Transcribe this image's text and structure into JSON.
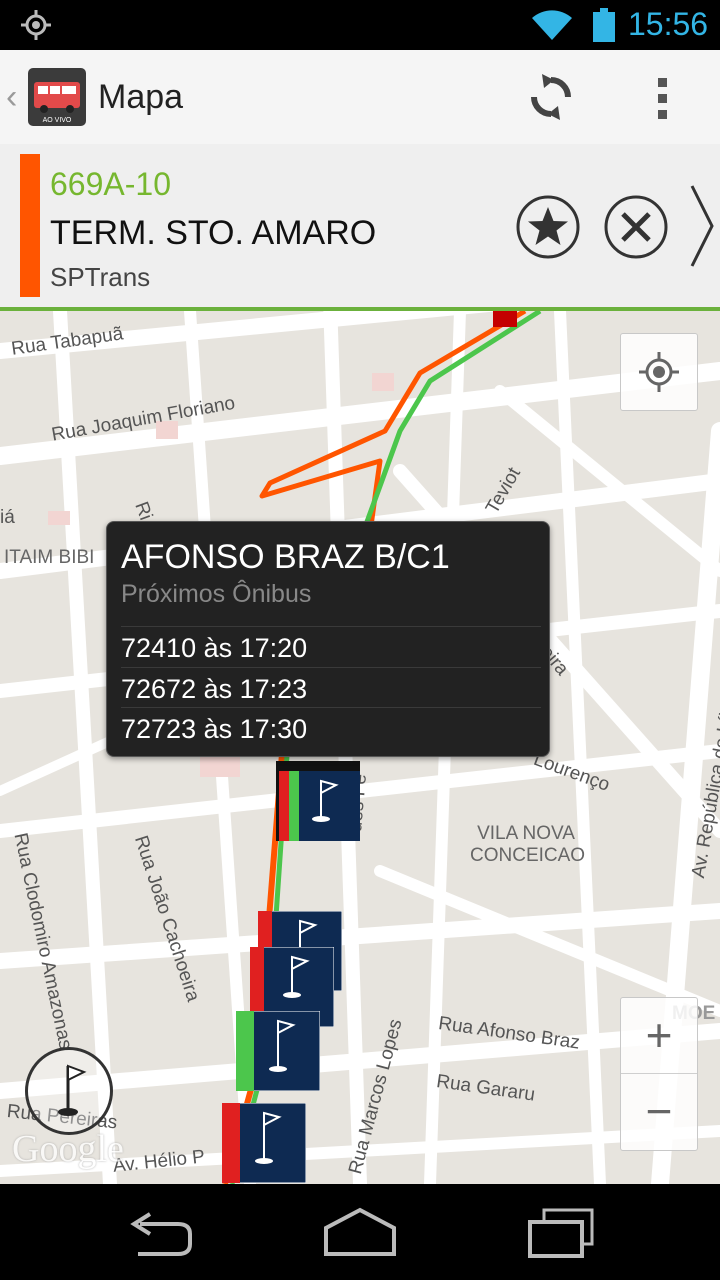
{
  "status_bar": {
    "time": "15:56"
  },
  "action_bar": {
    "title": "Mapa",
    "app_icon_text": "AO VIVO"
  },
  "route": {
    "code": "669A-10",
    "destination": "TERM. STO. AMARO",
    "operator": "SPTrans",
    "color": "#ff5500",
    "code_color": "#76b72f"
  },
  "map": {
    "streets": {
      "rua_tabapua": "Rua Tabapuã",
      "rua_joaquim_floriano": "Rua Joaquim Floriano",
      "teviot": "Teviot",
      "ia": "iá",
      "ri": "Ri",
      "reira": "reira",
      "lourenco": "Lourenço",
      "av_republica": "Av. República do Líbano",
      "rua_clodomiro": "Rua Clodomiro Amazonas",
      "rua_joao_cachoeira": "Rua João Cachoeira",
      "rua_afonso_braz": "Rua Afonso Braz",
      "rua_gararu": "Rua Gararu",
      "rua_marcos_lopes": "Rua Marcos Lopes",
      "ues_fe": "ues Fe",
      "rua_pereiras": "Rua Pereiras",
      "av_helio": "Av. Hélio P",
      "moe": "MOE"
    },
    "districts": {
      "itaim_bibi": "ITAIM BIBI",
      "vila_nova_conceicao": [
        "VILA NOVA",
        "CONCEICAO"
      ]
    },
    "watermark": "Google",
    "zoom_in": "+",
    "zoom_out": "−"
  },
  "popup": {
    "title": "AFONSO BRAZ B/C1",
    "subtitle": "Próximos Ônibus",
    "arrivals": [
      "72410 às 17:20",
      "72672 às 17:23",
      "72723 às 17:30"
    ]
  }
}
